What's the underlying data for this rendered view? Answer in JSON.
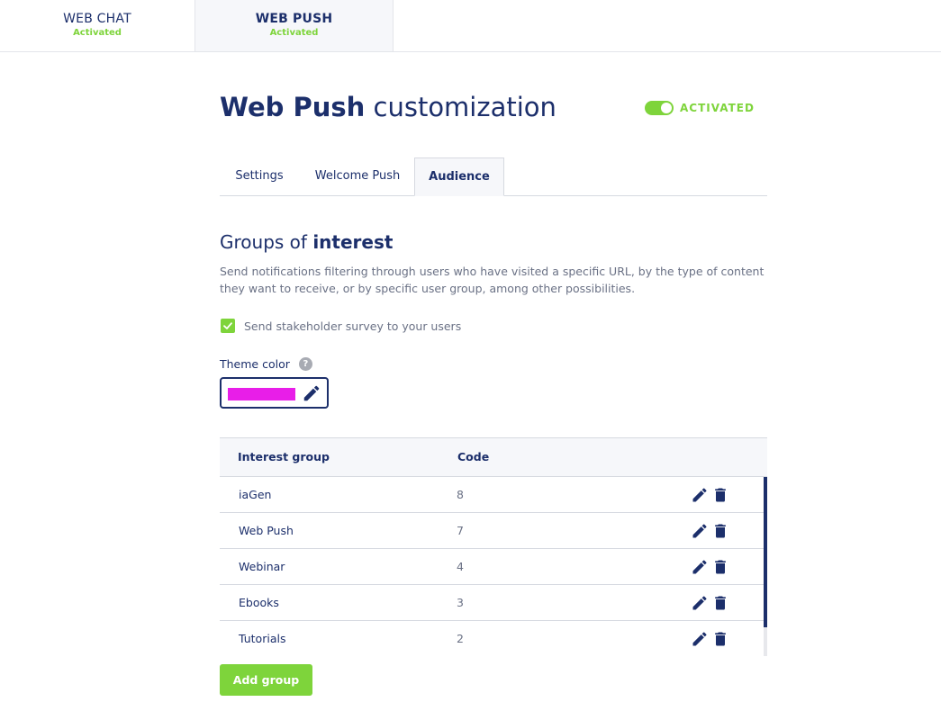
{
  "channels": [
    {
      "name": "WEB CHAT",
      "status": "Activated"
    },
    {
      "name": "WEB PUSH",
      "status": "Activated"
    }
  ],
  "header": {
    "title_bold": "Web Push",
    "title_rest": " customization",
    "toggle_label": "ACTIVATED"
  },
  "tabs": [
    {
      "label": "Settings"
    },
    {
      "label": "Welcome Push"
    },
    {
      "label": "Audience"
    }
  ],
  "groups": {
    "title_pre": "Groups of ",
    "title_bold": "interest",
    "description": "Send notifications filtering through users who have visited a specific URL, by the type of content they want to receive, or by specific user group, among other possibilities.",
    "checkbox_label": "Send stakeholder survey to your users",
    "checkbox_checked": true,
    "theme_label": "Theme color",
    "help_glyph": "?",
    "theme_color": "#e81ee8"
  },
  "table": {
    "headers": [
      "Interest group",
      "Code"
    ],
    "rows": [
      {
        "name": "iaGen",
        "code": "8"
      },
      {
        "name": "Web Push",
        "code": "7"
      },
      {
        "name": "Webinar",
        "code": "4"
      },
      {
        "name": "Ebooks",
        "code": "3"
      },
      {
        "name": "Tutorials",
        "code": "2"
      }
    ]
  },
  "add_button": "Add group",
  "colors": {
    "accent": "#7ed43b",
    "primary": "#1c2f6b"
  }
}
